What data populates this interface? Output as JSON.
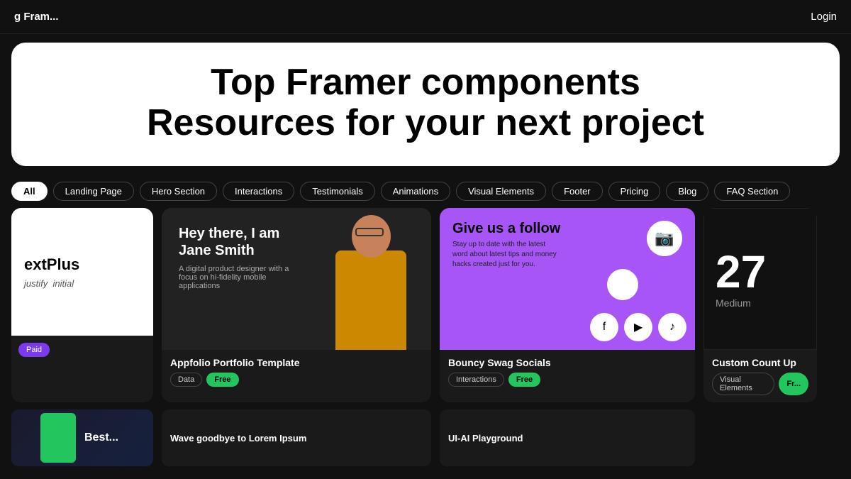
{
  "nav": {
    "logo": "g Fram...",
    "login": "Login"
  },
  "hero": {
    "line1": "Top Framer components",
    "line2": "Resources for your next project"
  },
  "filters": {
    "active": "All",
    "tags": [
      "All",
      "Landing Page",
      "Hero Section",
      "Interactions",
      "Testimonials",
      "Animations",
      "Visual Elements",
      "Footer",
      "Pricing",
      "Blog",
      "FAQ Section"
    ]
  },
  "cards": [
    {
      "id": "card-nextplus",
      "brand": "extPlus",
      "subtitle1": "justify",
      "subtitle2": "initial",
      "badge": "Paid",
      "badge_type": "paid"
    },
    {
      "id": "card-appfolio",
      "heading1": "Hey there, I am",
      "heading2": "Jane Smith",
      "description": "A digital product designer with a focus on hi-fidelity mobile applications",
      "title": "Appfolio Portfolio Template",
      "tags": [
        "Data",
        "Free"
      ]
    },
    {
      "id": "card-bouncy",
      "social_title": "Give us a follow",
      "social_subtitle": "Stay up to date with the latest word about latest tips and money hacks created just for you.",
      "title": "Bouncy Swag Socials",
      "tags": [
        "Interactions",
        "Free"
      ]
    },
    {
      "id": "card-counter",
      "number": "27",
      "label": "Medium",
      "title": "Custom Count Up",
      "tags": [
        "Visual Elements",
        "Fr..."
      ]
    }
  ],
  "second_row": [
    {
      "text": "Best..."
    },
    {
      "text": "Wave goodbye to Lorem Ipsum"
    },
    {
      "text": "UI-AI Playground"
    }
  ]
}
